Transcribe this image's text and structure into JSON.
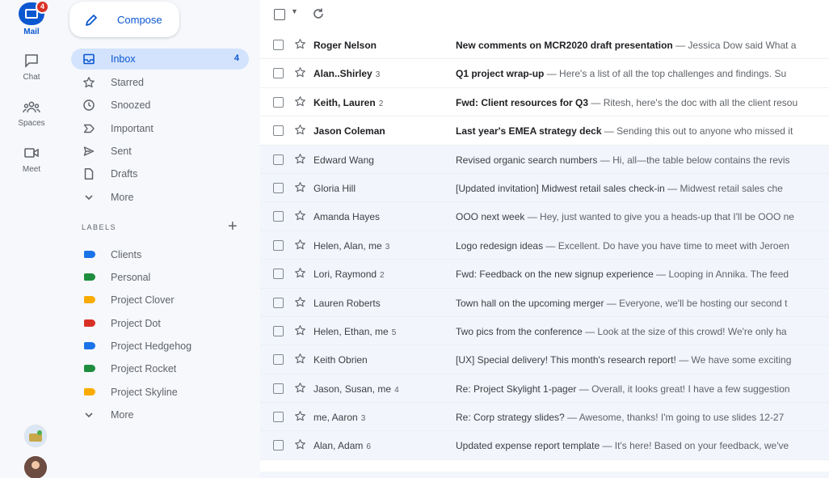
{
  "rail": {
    "mail": {
      "label": "Mail",
      "badge": "4"
    },
    "items": [
      {
        "label": "Chat",
        "icon": "chat-icon"
      },
      {
        "label": "Spaces",
        "icon": "spaces-icon"
      },
      {
        "label": "Meet",
        "icon": "video-camera-icon"
      }
    ]
  },
  "compose": {
    "label": "Compose",
    "icon": "pencil-icon"
  },
  "nav": [
    {
      "label": "Inbox",
      "count": "4",
      "icon": "inbox-icon",
      "active": true
    },
    {
      "label": "Starred",
      "count": "",
      "icon": "star-icon"
    },
    {
      "label": "Snoozed",
      "count": "",
      "icon": "clock-icon"
    },
    {
      "label": "Important",
      "count": "",
      "icon": "important-icon"
    },
    {
      "label": "Sent",
      "count": "",
      "icon": "send-icon"
    },
    {
      "label": "Drafts",
      "count": "",
      "icon": "draft-icon"
    },
    {
      "label": "More",
      "count": "",
      "icon": "chevron-down-icon"
    }
  ],
  "labels": {
    "title": "LABELS",
    "add": "+",
    "items": [
      {
        "name": "Clients",
        "color": "#1a73e8"
      },
      {
        "name": "Personal",
        "color": "#1e8e3e"
      },
      {
        "name": "Project Clover",
        "color": "#f9ab00"
      },
      {
        "name": "Project Dot",
        "color": "#d93025"
      },
      {
        "name": "Project Hedgehog",
        "color": "#1a73e8"
      },
      {
        "name": "Project Rocket",
        "color": "#1e8e3e"
      },
      {
        "name": "Project Skyline",
        "color": "#f9ab00"
      }
    ],
    "more": "More"
  },
  "emails": [
    {
      "sender": "Roger Nelson",
      "count": "",
      "subject": "New comments on MCR2020 draft presentation",
      "snippet": " — Jessica Dow said What a",
      "unread": true
    },
    {
      "sender": "Alan..Shirley",
      "count": "3",
      "subject": "Q1 project wrap-up",
      "snippet": " — Here's a list of all the top challenges and findings. Su",
      "unread": true
    },
    {
      "sender": "Keith, Lauren",
      "count": "2",
      "subject": "Fwd: Client resources for Q3",
      "snippet": " — Ritesh, here's the doc with all the client resou",
      "unread": true
    },
    {
      "sender": "Jason Coleman",
      "count": "",
      "subject": "Last year's EMEA strategy deck",
      "snippet": " — Sending this out to anyone who missed it",
      "unread": true
    },
    {
      "sender": "Edward Wang",
      "count": "",
      "subject": "Revised organic search numbers",
      "snippet": " — Hi, all—the table below contains the revis",
      "unread": false
    },
    {
      "sender": "Gloria Hill",
      "count": "",
      "subject": "[Updated invitation] Midwest retail sales check-in",
      "snippet": " — Midwest retail sales che",
      "unread": false
    },
    {
      "sender": "Amanda Hayes",
      "count": "",
      "subject": "OOO next week",
      "snippet": " — Hey, just wanted to give you a heads-up that I'll be OOO ne",
      "unread": false
    },
    {
      "sender": "Helen, Alan, me",
      "count": "3",
      "subject": "Logo redesign ideas",
      "snippet": " — Excellent. Do have you have time to meet with Jeroen",
      "unread": false
    },
    {
      "sender": "Lori, Raymond",
      "count": "2",
      "subject": "Fwd: Feedback on the new signup experience",
      "snippet": " — Looping in Annika. The feed",
      "unread": false
    },
    {
      "sender": "Lauren Roberts",
      "count": "",
      "subject": "Town hall on the upcoming merger",
      "snippet": " — Everyone, we'll be hosting our second t",
      "unread": false
    },
    {
      "sender": "Helen, Ethan, me",
      "count": "5",
      "subject": "Two pics from the conference",
      "snippet": " — Look at the size of this crowd! We're only ha",
      "unread": false
    },
    {
      "sender": "Keith Obrien",
      "count": "",
      "subject": "[UX] Special delivery! This month's research report!",
      "snippet": " — We have some exciting",
      "unread": false
    },
    {
      "sender": "Jason, Susan, me",
      "count": "4",
      "subject": "Re: Project Skylight 1-pager",
      "snippet": " — Overall, it looks great! I have a few suggestion",
      "unread": false
    },
    {
      "sender": "me, Aaron",
      "count": "3",
      "subject": "Re: Corp strategy slides?",
      "snippet": " — Awesome, thanks! I'm going to use slides 12-27",
      "unread": false
    },
    {
      "sender": "Alan, Adam",
      "count": "6",
      "subject": "Updated expense report template",
      "snippet": " — It's here! Based on your feedback, we've",
      "unread": false
    }
  ]
}
